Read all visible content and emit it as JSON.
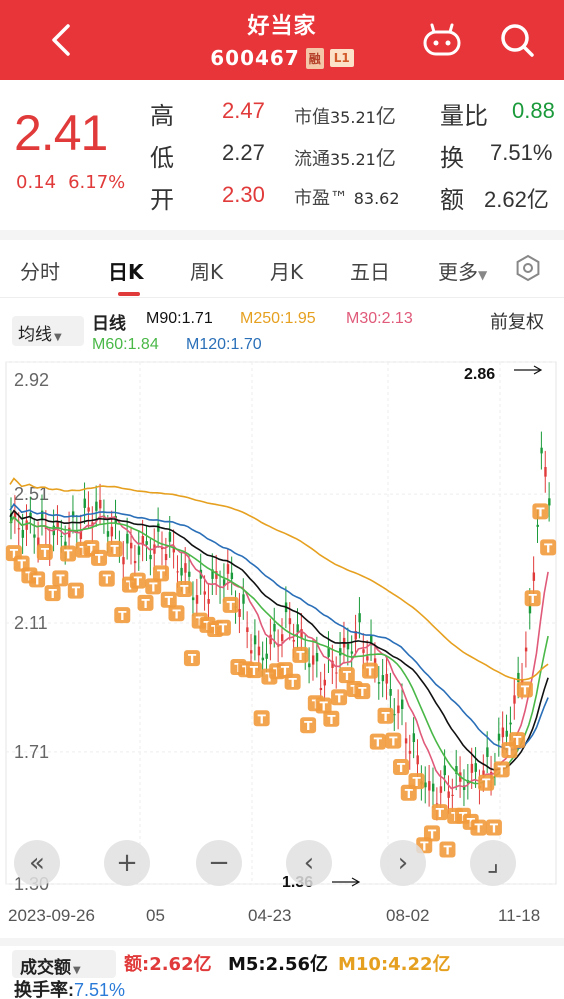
{
  "header": {
    "title": "好当家",
    "code": "600467",
    "badge_margin": "融",
    "badge_level": "L1"
  },
  "quote": {
    "price": "2.41",
    "change": "0.14",
    "change_pct": "6.17%",
    "high_label": "高",
    "high": "2.47",
    "low_label": "低",
    "low": "2.27",
    "open_label": "开",
    "open": "2.30",
    "mktcap_label": "市值",
    "mktcap": "35.21",
    "mktcap_unit": "亿",
    "float_label": "流通",
    "float": "35.21",
    "float_unit": "亿",
    "pe_label": "市盈™",
    "pe": "83.62",
    "vol_ratio_label": "量比",
    "vol_ratio": "0.88",
    "turnover_label": "换",
    "turnover": "7.51%",
    "amount_label": "额",
    "amount": "2.62",
    "amount_unit": "亿"
  },
  "tabs": [
    {
      "label": "分时"
    },
    {
      "label": "日K"
    },
    {
      "label": "周K"
    },
    {
      "label": "月K"
    },
    {
      "label": "五日"
    },
    {
      "label": "更多"
    }
  ],
  "indicators": {
    "selector": "均线",
    "kline_label": "日线",
    "m90": "M90:1.71",
    "m250": "M250:1.95",
    "m30": "M30:2.13",
    "m60": "M60:1.84",
    "m120": "M120:1.70",
    "adjust": "前复权"
  },
  "chart_data": {
    "type": "candlestick",
    "y_ticks": [
      "2.92",
      "2.51",
      "2.11",
      "1.71",
      "1.30"
    ],
    "x_ticks": [
      "2023-09-26",
      "05",
      "04-23",
      "08-02",
      "11-18"
    ],
    "max_label": "2.86",
    "min_label": "1.36",
    "ylim": [
      1.3,
      2.92
    ]
  },
  "volume": {
    "selector": "成交额",
    "amount": "额:2.62亿",
    "m5": "M5:2.56亿",
    "m10": "M10:4.22亿",
    "turnover_label": "换手率:",
    "turnover_value": "7.51%"
  },
  "colors": {
    "brand": "#e8353a",
    "up": "#e13a3a",
    "down": "#1a9a3a",
    "m90": "#111111",
    "m250": "#e6a020",
    "m30": "#e05a7a",
    "m60": "#4ab848",
    "m120": "#2a6fb8"
  }
}
